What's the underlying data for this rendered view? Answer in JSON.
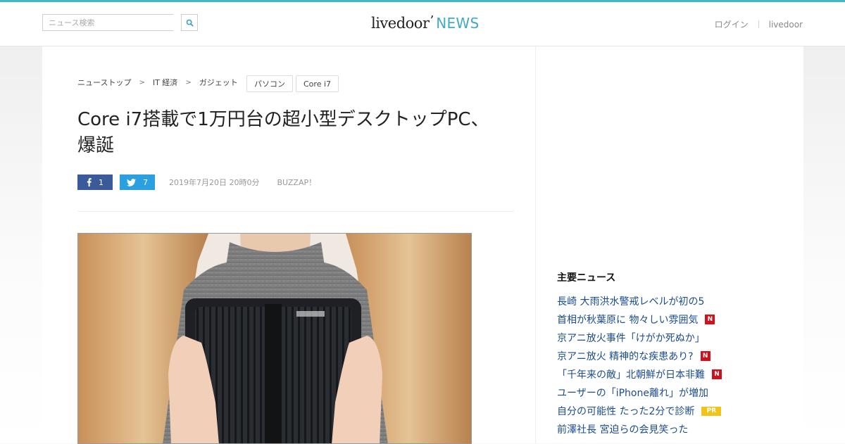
{
  "header": {
    "search_placeholder": "ニュース検索",
    "logo_main": "livedoor",
    "logo_accent": "NEWS",
    "links": [
      "ログイン",
      "livedoor"
    ]
  },
  "breadcrumb": [
    "ニューストップ",
    "IT 経済",
    "ガジェット"
  ],
  "tags": [
    "パソコン",
    "Core i7"
  ],
  "article": {
    "title": "Core i7搭載で1万円台の超小型デスクトップPC、爆誕",
    "facebook_count": "1",
    "twitter_count": "7",
    "date": "2019年7月20日 20時0分",
    "source": "BUZZAP！"
  },
  "sidebar": {
    "heading": "主要ニュース",
    "items": [
      {
        "text": "長崎 大雨洪水警戒レベルが初の5",
        "badge": ""
      },
      {
        "text": "首相が秋葉原に 物々しい雰囲気",
        "badge": "N"
      },
      {
        "text": "京アニ放火事件「けがか死ぬか」",
        "badge": ""
      },
      {
        "text": "京アニ放火 精神的な疾患あり?",
        "badge": "N"
      },
      {
        "text": "「千年来の敵」北朝鮮が日本非難",
        "badge": "N"
      },
      {
        "text": "ユーザーの「iPhone離れ」が増加",
        "badge": ""
      },
      {
        "text": "自分の可能性 たった2分で診断",
        "badge": "PR"
      },
      {
        "text": "前澤社長 宮迫らの会見笑った",
        "badge": ""
      }
    ]
  },
  "colors": {
    "accent": "#43b6cf",
    "link": "#1b4c8c",
    "facebook": "#3b5a9a",
    "twitter": "#2ba0e0",
    "badge_n": "#d0101a",
    "badge_pr": "#f0c418"
  }
}
